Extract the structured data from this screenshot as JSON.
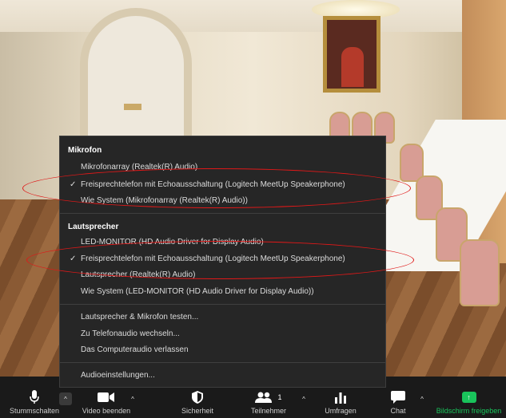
{
  "audio_menu": {
    "microphone": {
      "heading": "Mikrofon",
      "items": [
        {
          "label": "Mikrofonarray (Realtek(R) Audio)",
          "checked": false
        },
        {
          "label": "Freisprechtelefon mit Echoausschaltung (Logitech MeetUp Speakerphone)",
          "checked": true
        },
        {
          "label": "Wie System (Mikrofonarray (Realtek(R) Audio))",
          "checked": false
        }
      ]
    },
    "speaker": {
      "heading": "Lautsprecher",
      "items": [
        {
          "label": "LED-MONITOR (HD Audio Driver for Display Audio)",
          "checked": false
        },
        {
          "label": "Freisprechtelefon mit Echoausschaltung (Logitech MeetUp Speakerphone)",
          "checked": true
        },
        {
          "label": "Lautsprecher (Realtek(R) Audio)",
          "checked": false
        },
        {
          "label": "Wie System (LED-MONITOR (HD Audio Driver for Display Audio))",
          "checked": false
        }
      ]
    },
    "actions": [
      {
        "label": "Lautsprecher & Mikrofon testen..."
      },
      {
        "label": "Zu Telefonaudio wechseln..."
      },
      {
        "label": "Das Computeraudio verlassen"
      }
    ],
    "settings": {
      "label": "Audioeinstellungen..."
    },
    "checkmark": "✓"
  },
  "toolbar": {
    "mute": {
      "label": "Stummschalten",
      "icon": "microphone-icon"
    },
    "video": {
      "label": "Video beenden",
      "icon": "video-camera-icon"
    },
    "security": {
      "label": "Sicherheit",
      "icon": "shield-icon"
    },
    "participants": {
      "label": "Teilnehmer",
      "count": "1",
      "icon": "people-icon"
    },
    "polls": {
      "label": "Umfragen",
      "icon": "bar-chart-icon"
    },
    "chat": {
      "label": "Chat",
      "icon": "chat-bubble-icon"
    },
    "share": {
      "label": "Bildschirm freigeben",
      "icon": "share-screen-icon",
      "color": "#19c35b"
    },
    "caret": "^"
  },
  "colors": {
    "menu_bg": "#262626",
    "annotation_red": "#e01818",
    "share_green": "#19c35b"
  }
}
